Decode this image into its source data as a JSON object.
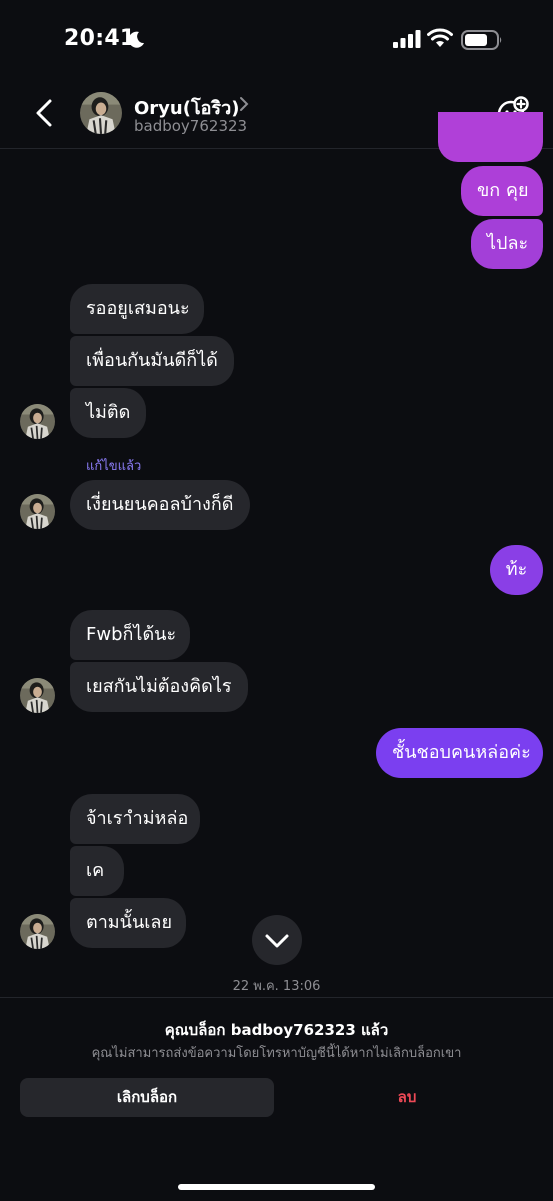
{
  "status_bar": {
    "time": "20:41"
  },
  "header": {
    "name": "Oryu(โอริว)",
    "username": "badboy762323"
  },
  "messages": {
    "m1": "ขก คุย",
    "m2": "ไปละ",
    "m3": "รออยูเสมอนะ",
    "m4": "เพื่อนกันมันดีก็ได้",
    "m5": "ไม่ติด",
    "edited_label": "แก้ไขแล้ว",
    "m6": "เงี่ยนยนคอลบ้างก็ดี",
    "m7": "ท้ะ",
    "m8": "Fwbก็ได้นะ",
    "m9": "เยสกันไม่ต้องคิดไร",
    "m10": "ชั้นชอบคนหล่อค่ะ",
    "m11": "จ้าเราำม่หล่อ",
    "m12": "เค",
    "m13": "ตามนั้นเลย"
  },
  "date_label": "22 พ.ค. 13:06",
  "block_panel": {
    "title": "คุณบล็อก badboy762323 แล้ว",
    "subtitle": "คุณไม่สามารถส่งข้อความโดยโทรหาบัญชีนี้ได้หากไม่เลิกบล็อกเขา",
    "unblock_label": "เลิกบล็อก",
    "delete_label": "ลบ"
  },
  "colors": {
    "sent_purple": "#9b3fd6",
    "sent_violet": "#7b3ff0",
    "received_bg": "#26272c",
    "delete_red": "#ed4956"
  },
  "icons": [
    "moon-icon",
    "signal-icon",
    "wifi-icon",
    "battery-icon",
    "back-chevron-icon",
    "chevron-right-icon",
    "sticker-add-icon",
    "chevron-down-icon"
  ]
}
